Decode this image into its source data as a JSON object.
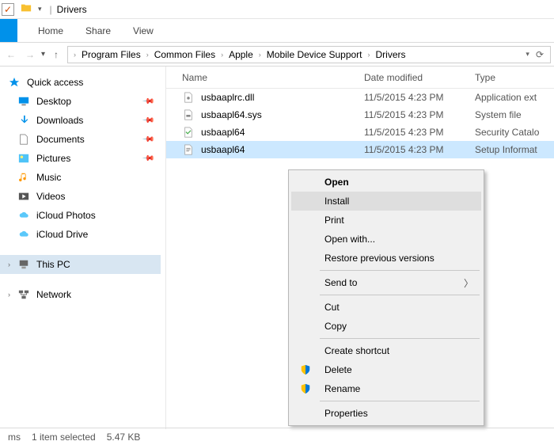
{
  "title": "Drivers",
  "tabs": {
    "home": "Home",
    "share": "Share",
    "view": "View"
  },
  "breadcrumbs": [
    "Program Files",
    "Common Files",
    "Apple",
    "Mobile Device Support",
    "Drivers"
  ],
  "columns": {
    "name": "Name",
    "date": "Date modified",
    "type": "Type"
  },
  "nav": {
    "quick": "Quick access",
    "items": [
      {
        "label": "Desktop",
        "pin": true
      },
      {
        "label": "Downloads",
        "pin": true
      },
      {
        "label": "Documents",
        "pin": true
      },
      {
        "label": "Pictures",
        "pin": true
      },
      {
        "label": "Music",
        "pin": false
      },
      {
        "label": "Videos",
        "pin": false
      },
      {
        "label": "iCloud Photos",
        "pin": false
      },
      {
        "label": "iCloud Drive",
        "pin": false
      }
    ],
    "thispc": "This PC",
    "network": "Network"
  },
  "files": [
    {
      "name": "usbaaplrc.dll",
      "date": "11/5/2015 4:23 PM",
      "type": "Application ext"
    },
    {
      "name": "usbaapl64.sys",
      "date": "11/5/2015 4:23 PM",
      "type": "System file"
    },
    {
      "name": "usbaapl64",
      "date": "11/5/2015 4:23 PM",
      "type": "Security Catalo"
    },
    {
      "name": "usbaapl64",
      "date": "11/5/2015 4:23 PM",
      "type": "Setup Informat"
    }
  ],
  "ctx": {
    "open": "Open",
    "install": "Install",
    "print": "Print",
    "openwith": "Open with...",
    "restore": "Restore previous versions",
    "sendto": "Send to",
    "cut": "Cut",
    "copy": "Copy",
    "shortcut": "Create shortcut",
    "delete": "Delete",
    "rename": "Rename",
    "props": "Properties"
  },
  "status": {
    "items": "ms",
    "sel": "1 item selected",
    "size": "5.47 KB"
  }
}
